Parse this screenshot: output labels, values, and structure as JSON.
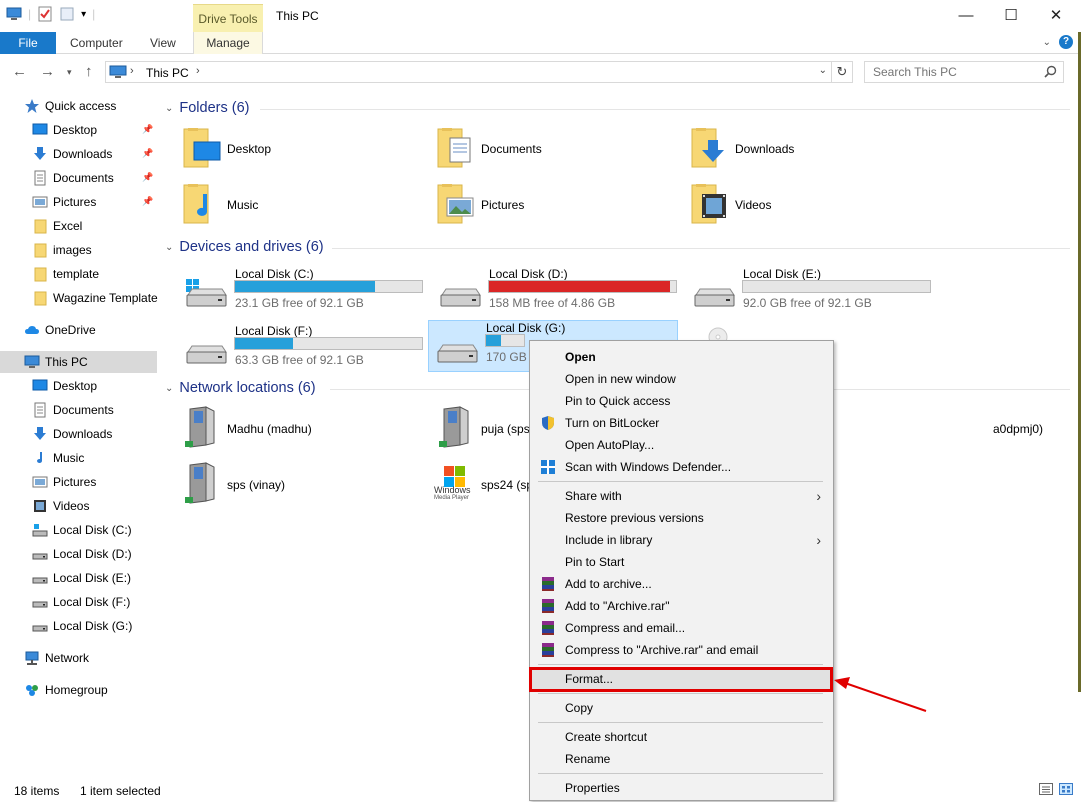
{
  "window": {
    "title": "This PC",
    "contextual_tab_group": "Drive Tools",
    "minimize": "—",
    "maximize": "☐",
    "close": "✕"
  },
  "ribbon": {
    "tabs": [
      "File",
      "Computer",
      "View",
      "Manage"
    ],
    "active_tab": "Manage"
  },
  "address_bar": {
    "path": "This PC",
    "separator": "›",
    "search_placeholder": "Search This PC"
  },
  "nav_pane": {
    "items": [
      {
        "label": "Quick access",
        "icon": "star-icon",
        "pinned": false,
        "level": 0
      },
      {
        "label": "Desktop",
        "icon": "desktop-icon",
        "pinned": true,
        "level": 1
      },
      {
        "label": "Downloads",
        "icon": "download-icon",
        "pinned": true,
        "level": 1
      },
      {
        "label": "Documents",
        "icon": "document-icon",
        "pinned": true,
        "level": 1
      },
      {
        "label": "Pictures",
        "icon": "picture-icon",
        "pinned": true,
        "level": 1
      },
      {
        "label": "Excel",
        "icon": "folder-icon",
        "pinned": false,
        "level": 1
      },
      {
        "label": "images",
        "icon": "folder-icon",
        "pinned": false,
        "level": 1
      },
      {
        "label": "template",
        "icon": "folder-icon",
        "pinned": false,
        "level": 1
      },
      {
        "label": "Wagazine Template",
        "icon": "folder-icon",
        "pinned": false,
        "level": 1
      },
      {
        "label": "OneDrive",
        "icon": "cloud-icon",
        "pinned": false,
        "level": 0
      },
      {
        "label": "This PC",
        "icon": "computer-icon",
        "pinned": false,
        "level": 0,
        "selected": true
      },
      {
        "label": "Desktop",
        "icon": "desktop-icon",
        "pinned": false,
        "level": 1
      },
      {
        "label": "Documents",
        "icon": "document-icon",
        "pinned": false,
        "level": 1
      },
      {
        "label": "Downloads",
        "icon": "download-icon",
        "pinned": false,
        "level": 1
      },
      {
        "label": "Music",
        "icon": "music-icon",
        "pinned": false,
        "level": 1
      },
      {
        "label": "Pictures",
        "icon": "picture-icon",
        "pinned": false,
        "level": 1
      },
      {
        "label": "Videos",
        "icon": "video-icon",
        "pinned": false,
        "level": 1
      },
      {
        "label": "Local Disk (C:)",
        "icon": "drive-c-icon",
        "pinned": false,
        "level": 1
      },
      {
        "label": "Local Disk (D:)",
        "icon": "drive-icon",
        "pinned": false,
        "level": 1
      },
      {
        "label": "Local Disk (E:)",
        "icon": "drive-icon",
        "pinned": false,
        "level": 1
      },
      {
        "label": "Local Disk (F:)",
        "icon": "drive-icon",
        "pinned": false,
        "level": 1
      },
      {
        "label": "Local Disk (G:)",
        "icon": "drive-icon",
        "pinned": false,
        "level": 1
      },
      {
        "label": "Network",
        "icon": "network-icon",
        "pinned": false,
        "level": 0
      },
      {
        "label": "Homegroup",
        "icon": "homegroup-icon",
        "pinned": false,
        "level": 0
      }
    ]
  },
  "content": {
    "folders_header": "Folders (6)",
    "folders": [
      {
        "name": "Desktop",
        "icon": "desktop-folder-icon"
      },
      {
        "name": "Documents",
        "icon": "documents-folder-icon"
      },
      {
        "name": "Downloads",
        "icon": "downloads-folder-icon"
      },
      {
        "name": "Music",
        "icon": "music-folder-icon"
      },
      {
        "name": "Pictures",
        "icon": "pictures-folder-icon"
      },
      {
        "name": "Videos",
        "icon": "videos-folder-icon"
      }
    ],
    "drives_header": "Devices and drives (6)",
    "drives": [
      {
        "name": "Local Disk (C:)",
        "free": "23.1 GB free of 92.1 GB",
        "used_fraction": 0.75,
        "bar_color": "#26a0da",
        "windows": true
      },
      {
        "name": "Local Disk (D:)",
        "free": "158 MB free of 4.86 GB",
        "used_fraction": 0.97,
        "bar_color": "#da2626"
      },
      {
        "name": "Local Disk (E:)",
        "free": "92.0 GB free of 92.1 GB",
        "used_fraction": 0.0,
        "bar_color": "#26a0da"
      },
      {
        "name": "Local Disk (F:)",
        "free": "63.3 GB free of 92.1 GB",
        "used_fraction": 0.31,
        "bar_color": "#26a0da"
      },
      {
        "name": "Local Disk (G:)",
        "free": "170 GB f",
        "used_fraction": 0.09,
        "bar_color": "#26a0da",
        "selected": true
      }
    ],
    "network_header": "Network locations (6)",
    "network": [
      {
        "name": "Madhu (madhu)",
        "icon": "network-drive-icon"
      },
      {
        "name": "puja (sps",
        "icon": "network-drive-icon"
      },
      {
        "name": "a0dpmj0)",
        "icon": "network-drive-icon"
      },
      {
        "name": "sps (vinay)",
        "icon": "network-drive-icon"
      },
      {
        "name": "sps24 (sp",
        "icon": "windows-media-player-icon",
        "caption": "Windows",
        "caption2": "Media Player"
      }
    ]
  },
  "context_menu": {
    "items": [
      {
        "label": "Open",
        "bold": true
      },
      {
        "label": "Open in new window"
      },
      {
        "label": "Pin to Quick access"
      },
      {
        "label": "Turn on BitLocker",
        "icon": "shield-icon"
      },
      {
        "label": "Open AutoPlay..."
      },
      {
        "label": "Scan with Windows Defender...",
        "icon": "defender-icon"
      },
      {
        "separator": true
      },
      {
        "label": "Share with",
        "submenu": true
      },
      {
        "label": "Restore previous versions"
      },
      {
        "label": "Include in library",
        "submenu": true
      },
      {
        "label": "Pin to Start"
      },
      {
        "label": "Add to archive...",
        "icon": "winrar-icon"
      },
      {
        "label": "Add to \"Archive.rar\"",
        "icon": "winrar-icon"
      },
      {
        "label": "Compress and email...",
        "icon": "winrar-icon"
      },
      {
        "label": "Compress to \"Archive.rar\" and email",
        "icon": "winrar-icon"
      },
      {
        "separator": true
      },
      {
        "label": "Format...",
        "highlighted": true
      },
      {
        "separator": true
      },
      {
        "label": "Copy"
      },
      {
        "separator": true
      },
      {
        "label": "Create shortcut"
      },
      {
        "label": "Rename"
      },
      {
        "separator": true
      },
      {
        "label": "Properties"
      }
    ]
  },
  "status_bar": {
    "items_count": "18 items",
    "selection": "1 item selected"
  },
  "colors": {
    "accent": "#1979ca",
    "header_blue": "#1e3287",
    "selection": "#cce8ff",
    "annotation_red": "#e00000"
  }
}
